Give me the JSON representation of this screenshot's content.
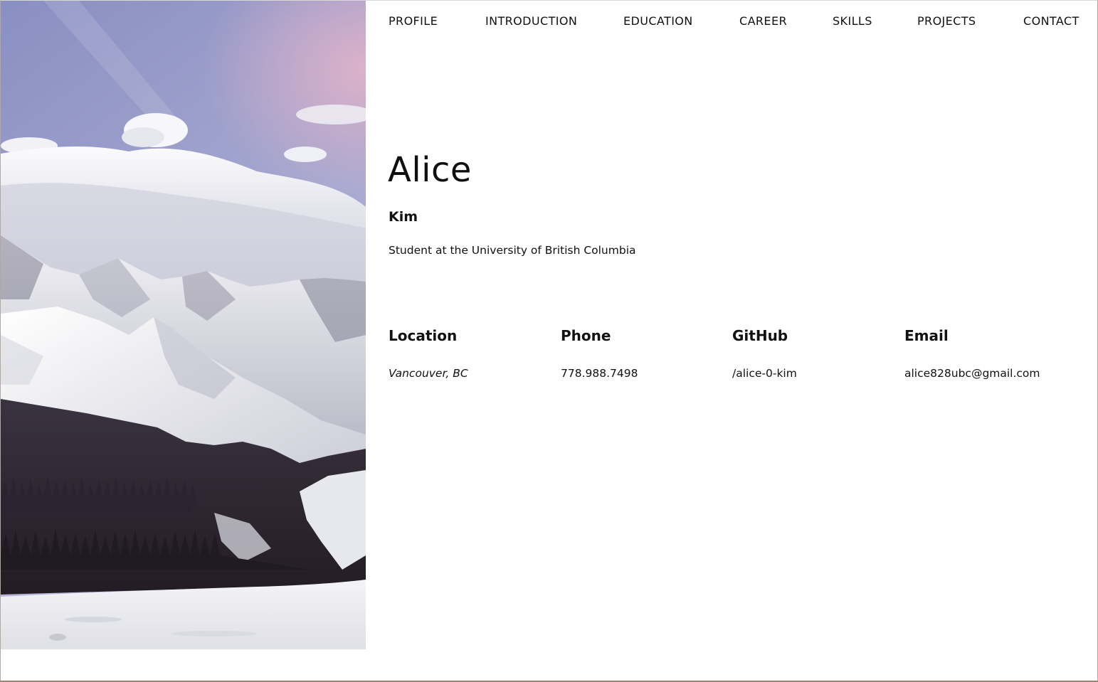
{
  "nav": {
    "items": [
      {
        "label": "PROFILE"
      },
      {
        "label": "INTRODUCTION"
      },
      {
        "label": "EDUCATION"
      },
      {
        "label": "CAREER"
      },
      {
        "label": "SKILLS"
      },
      {
        "label": "PROJECTS"
      },
      {
        "label": "CONTACT"
      }
    ]
  },
  "hero": {
    "first_name": "Alice",
    "last_name": "Kim",
    "subtitle": "Student at the University of British Columbia"
  },
  "info": {
    "location": {
      "label": "Location",
      "value": "Vancouver, BC"
    },
    "phone": {
      "label": "Phone",
      "value": "778.988.7498"
    },
    "github": {
      "label": "GitHub",
      "value": "/alice-0-kim"
    },
    "email": {
      "label": "Email",
      "value": "alice828ubc@gmail.com"
    }
  },
  "colors": {
    "sky_top": "#8e93c4",
    "sky_pink": "#c9a9c8",
    "snow": "#eef0f4",
    "forest": "#2a2430"
  }
}
